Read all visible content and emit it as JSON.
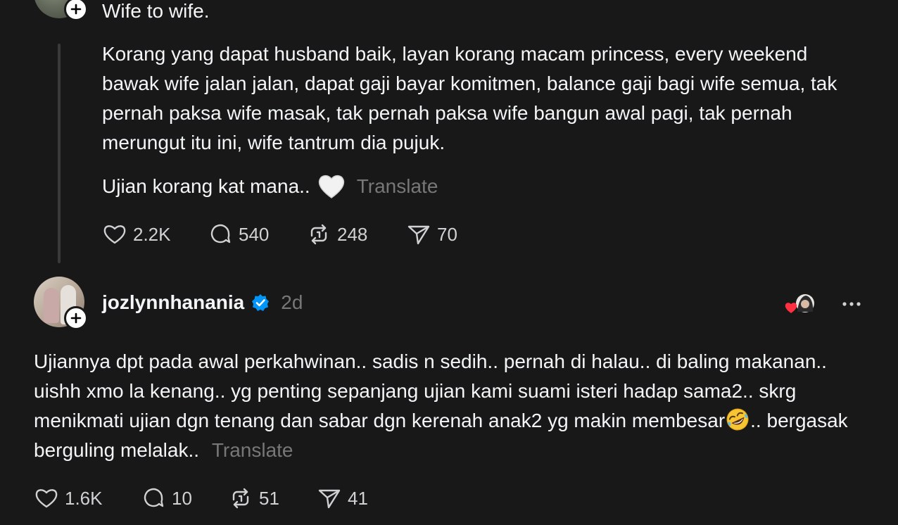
{
  "quoted_post": {
    "title": "Wife to wife.",
    "body": "Korang yang dapat husband baik, layan korang macam princess, every weekend bawak wife jalan jalan, dapat gaji bayar komitmen, balance gaji bagi wife semua, tak pernah paksa wife masak, tak pernah paksa wife bangun awal pagi, tak pernah merungut itu ini, wife tantrum dia pujuk.",
    "closing": "Ujian korang kat mana..",
    "closing_emoji": "white-heart-emoji",
    "translate": "Translate",
    "stats": {
      "likes": "2.2K",
      "replies": "540",
      "reposts": "248",
      "shares": "70"
    }
  },
  "reply_post": {
    "username": "jozlynnhanania",
    "verified": true,
    "timestamp": "2d",
    "body_part1": "Ujiannya dpt pada awal perkahwinan.. sadis n sedih.. pernah di halau.. di baling makanan.. uishh xmo la kenang.. yg penting sepanjang ujian kami suami isteri hadap sama2.. skrg menikmati ujian dgn tenang dan sabar dgn kerenah anak2 yg makin membesar",
    "body_emoji": "rolling-on-floor-laughing-emoji",
    "body_part2": ".. bergasak berguling melalak..",
    "translate": "Translate",
    "stats": {
      "likes": "1.6K",
      "replies": "10",
      "reposts": "51",
      "shares": "41"
    }
  },
  "colors": {
    "background": "#181818",
    "text": "#f3f5f7",
    "muted": "#777777",
    "verified": "#0095f6",
    "thread_line": "#3a3a3a"
  }
}
